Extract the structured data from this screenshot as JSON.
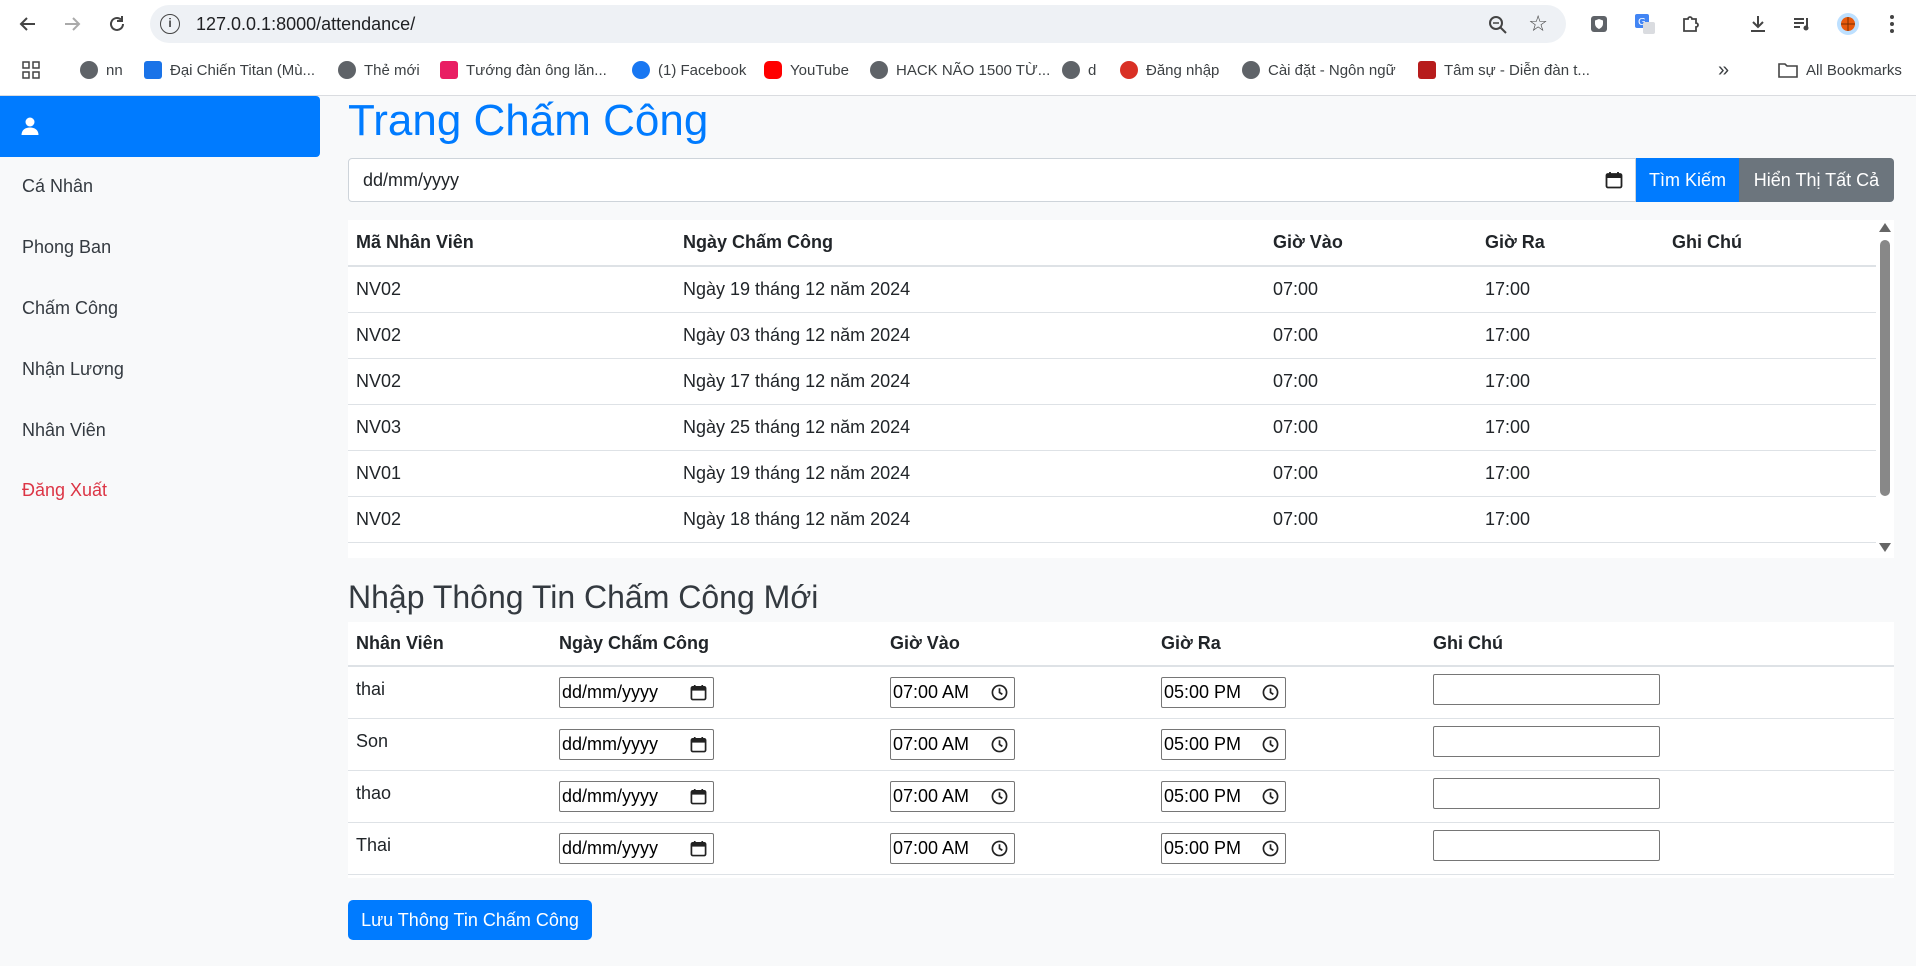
{
  "browser": {
    "url": "127.0.0.1:8000/attendance/",
    "bookmarks": [
      {
        "label": "nn",
        "color": "#5f6368"
      },
      {
        "label": "Đại Chiến Titan (Mù...",
        "color": "#1a73e8"
      },
      {
        "label": "Thẻ mới",
        "color": "#5f6368"
      },
      {
        "label": "Tướng đàn ông lăn...",
        "color": "#e91e63"
      },
      {
        "label": "(1) Facebook",
        "color": "#1877f2"
      },
      {
        "label": "YouTube",
        "color": "#ff0000"
      },
      {
        "label": "HACK NÃO 1500 TỪ...",
        "color": "#5f6368"
      },
      {
        "label": "d",
        "color": "#5f6368"
      },
      {
        "label": "Đăng nhập",
        "color": "#d93025"
      },
      {
        "label": "Cài đặt - Ngôn ngữ",
        "color": "#5f6368"
      },
      {
        "label": "Tâm sự - Diễn đàn t...",
        "color": "#b71c1c"
      }
    ],
    "all_bookmarks": "All Bookmarks",
    "more": "»"
  },
  "sidebar": {
    "items": [
      {
        "label": "Cá Nhân"
      },
      {
        "label": "Phong Ban"
      },
      {
        "label": "Chấm Công"
      },
      {
        "label": "Nhận Lương"
      },
      {
        "label": "Nhân Viên"
      },
      {
        "label": "Đăng Xuất"
      }
    ]
  },
  "main": {
    "title": "Trang Chấm Công",
    "search": {
      "date_placeholder": "dd/mm/yyyy",
      "search_label": "Tìm Kiếm",
      "show_all_label": "Hiển Thị Tất Cả"
    },
    "attendance_table": {
      "headers": [
        "Mã Nhân Viên",
        "Ngày Chấm Công",
        "Giờ Vào",
        "Giờ Ra",
        "Ghi Chú"
      ],
      "rows": [
        [
          "NV02",
          "Ngày 19 tháng 12 năm 2024",
          "07:00",
          "17:00",
          ""
        ],
        [
          "NV02",
          "Ngày 03 tháng 12 năm 2024",
          "07:00",
          "17:00",
          ""
        ],
        [
          "NV02",
          "Ngày 17 tháng 12 năm 2024",
          "07:00",
          "17:00",
          ""
        ],
        [
          "NV03",
          "Ngày 25 tháng 12 năm 2024",
          "07:00",
          "17:00",
          ""
        ],
        [
          "NV01",
          "Ngày 19 tháng 12 năm 2024",
          "07:00",
          "17:00",
          ""
        ],
        [
          "NV02",
          "Ngày 18 tháng 12 năm 2024",
          "07:00",
          "17:00",
          ""
        ]
      ]
    },
    "new_entry": {
      "title": "Nhập Thông Tin Chấm Công Mới",
      "headers": [
        "Nhân Viên",
        "Ngày Chấm Công",
        "Giờ Vào",
        "Giờ Ra",
        "Ghi Chú"
      ],
      "rows": [
        {
          "name": "thai",
          "date": "dd/mm/yyyy",
          "time_in": "07:00 AM",
          "time_out": "05:00 PM",
          "note": ""
        },
        {
          "name": "Son",
          "date": "dd/mm/yyyy",
          "time_in": "07:00 AM",
          "time_out": "05:00 PM",
          "note": ""
        },
        {
          "name": "thao",
          "date": "dd/mm/yyyy",
          "time_in": "07:00 AM",
          "time_out": "05:00 PM",
          "note": ""
        },
        {
          "name": "Thai",
          "date": "dd/mm/yyyy",
          "time_in": "07:00 AM",
          "time_out": "05:00 PM",
          "note": ""
        }
      ],
      "save_label": "Lưu Thông Tin Chấm Công"
    }
  }
}
